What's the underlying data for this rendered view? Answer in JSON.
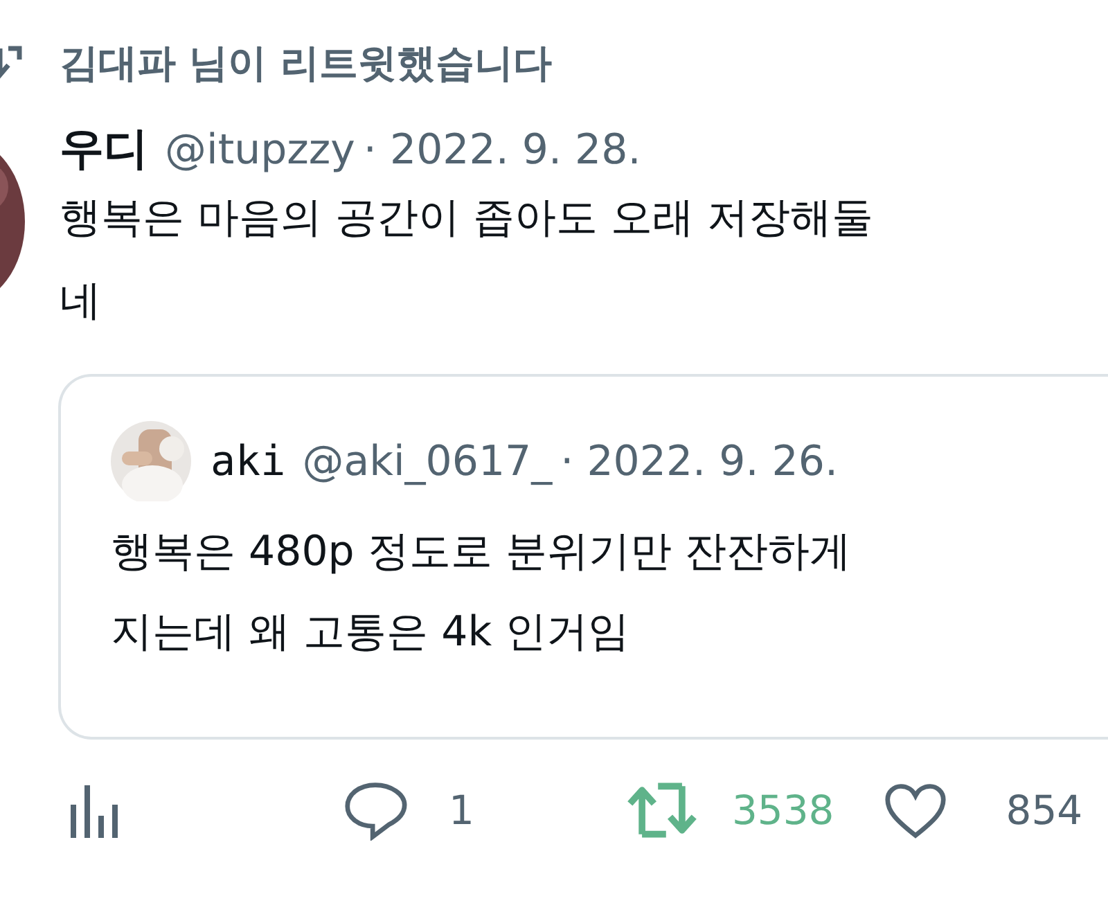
{
  "retweet_banner": {
    "text": "김대파 님이 리트윗했습니다"
  },
  "tweet": {
    "name": "우디",
    "handle": "@itupzzy",
    "date": "· 2022. 9. 28.",
    "lines": [
      "행복은 마음의 공간이 좁아도 오래 저장해둘",
      "네"
    ],
    "quote": {
      "name": "aki",
      "handle": "@aki_0617_",
      "date": "· 2022. 9. 26.",
      "lines": [
        "행복은 480p 정도로 분위기만 잔잔하게",
        "지는데 왜 고통은 4k 인거임"
      ]
    },
    "actions": {
      "replies": "1",
      "retweets": "3538",
      "retweeted": true,
      "likes": "854",
      "liked": false
    }
  }
}
